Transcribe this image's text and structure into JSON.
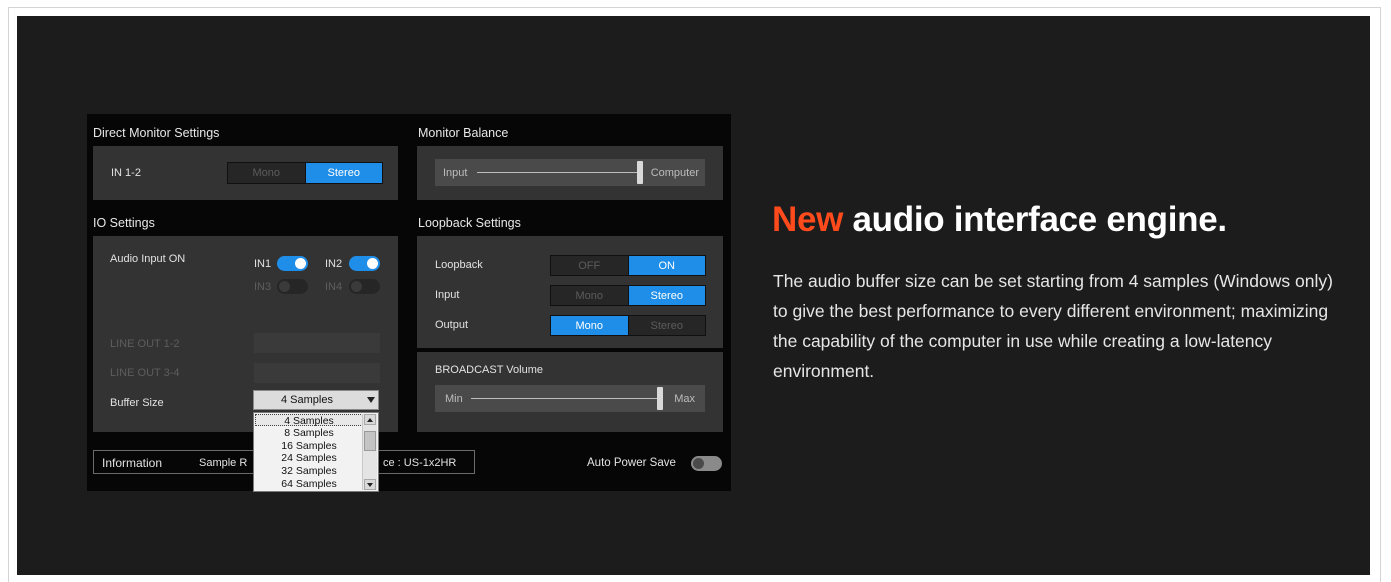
{
  "app": {
    "direct_monitor": {
      "title": "Direct Monitor Settings",
      "channel_label": "IN 1-2",
      "mode_options": [
        "Mono",
        "Stereo"
      ],
      "selected_mode": "Stereo"
    },
    "monitor_balance": {
      "title": "Monitor Balance",
      "left_label": "Input",
      "right_label": "Computer",
      "value_percent": 100
    },
    "io_settings": {
      "title": "IO Settings",
      "audio_input_label": "Audio Input ON",
      "inputs": [
        {
          "label": "IN1",
          "on": true,
          "enabled": true
        },
        {
          "label": "IN2",
          "on": true,
          "enabled": true
        },
        {
          "label": "IN3",
          "on": false,
          "enabled": false
        },
        {
          "label": "IN4",
          "on": false,
          "enabled": false
        }
      ],
      "line_out_1": "LINE OUT 1-2",
      "line_out_2": "LINE OUT 3-4",
      "buffer_size_label": "Buffer Size",
      "buffer_size_value": "4 Samples",
      "buffer_size_options": [
        "4 Samples",
        "8 Samples",
        "16 Samples",
        "24 Samples",
        "32 Samples",
        "64 Samples"
      ]
    },
    "loopback": {
      "title": "Loopback Settings",
      "loopback_label": "Loopback",
      "loopback_options": [
        "OFF",
        "ON"
      ],
      "loopback_selected": "ON",
      "input_label": "Input",
      "input_options": [
        "Mono",
        "Stereo"
      ],
      "input_selected": "Stereo",
      "output_label": "Output",
      "output_options": [
        "Mono",
        "Stereo"
      ],
      "output_selected": "Mono"
    },
    "broadcast": {
      "title": "BROADCAST Volume",
      "min_label": "Min",
      "max_label": "Max",
      "value_percent": 100
    },
    "information": {
      "label": "Information",
      "sample_rate_fragment": "Sample R",
      "device_fragment": "ce : US-1x2HR"
    },
    "auto_power_save": {
      "label": "Auto Power Save",
      "on": false
    }
  },
  "marketing": {
    "headline_accent": "New",
    "headline_rest": " audio interface engine.",
    "body": "The audio buffer size can be set starting from 4 samples (Windows only) to give the best performance to every different environment; maximizing the capability of the computer in use while creating a low-latency environment.",
    "accent_color": "#ff4a1c",
    "toggle_on_color": "#1f8ee8"
  }
}
